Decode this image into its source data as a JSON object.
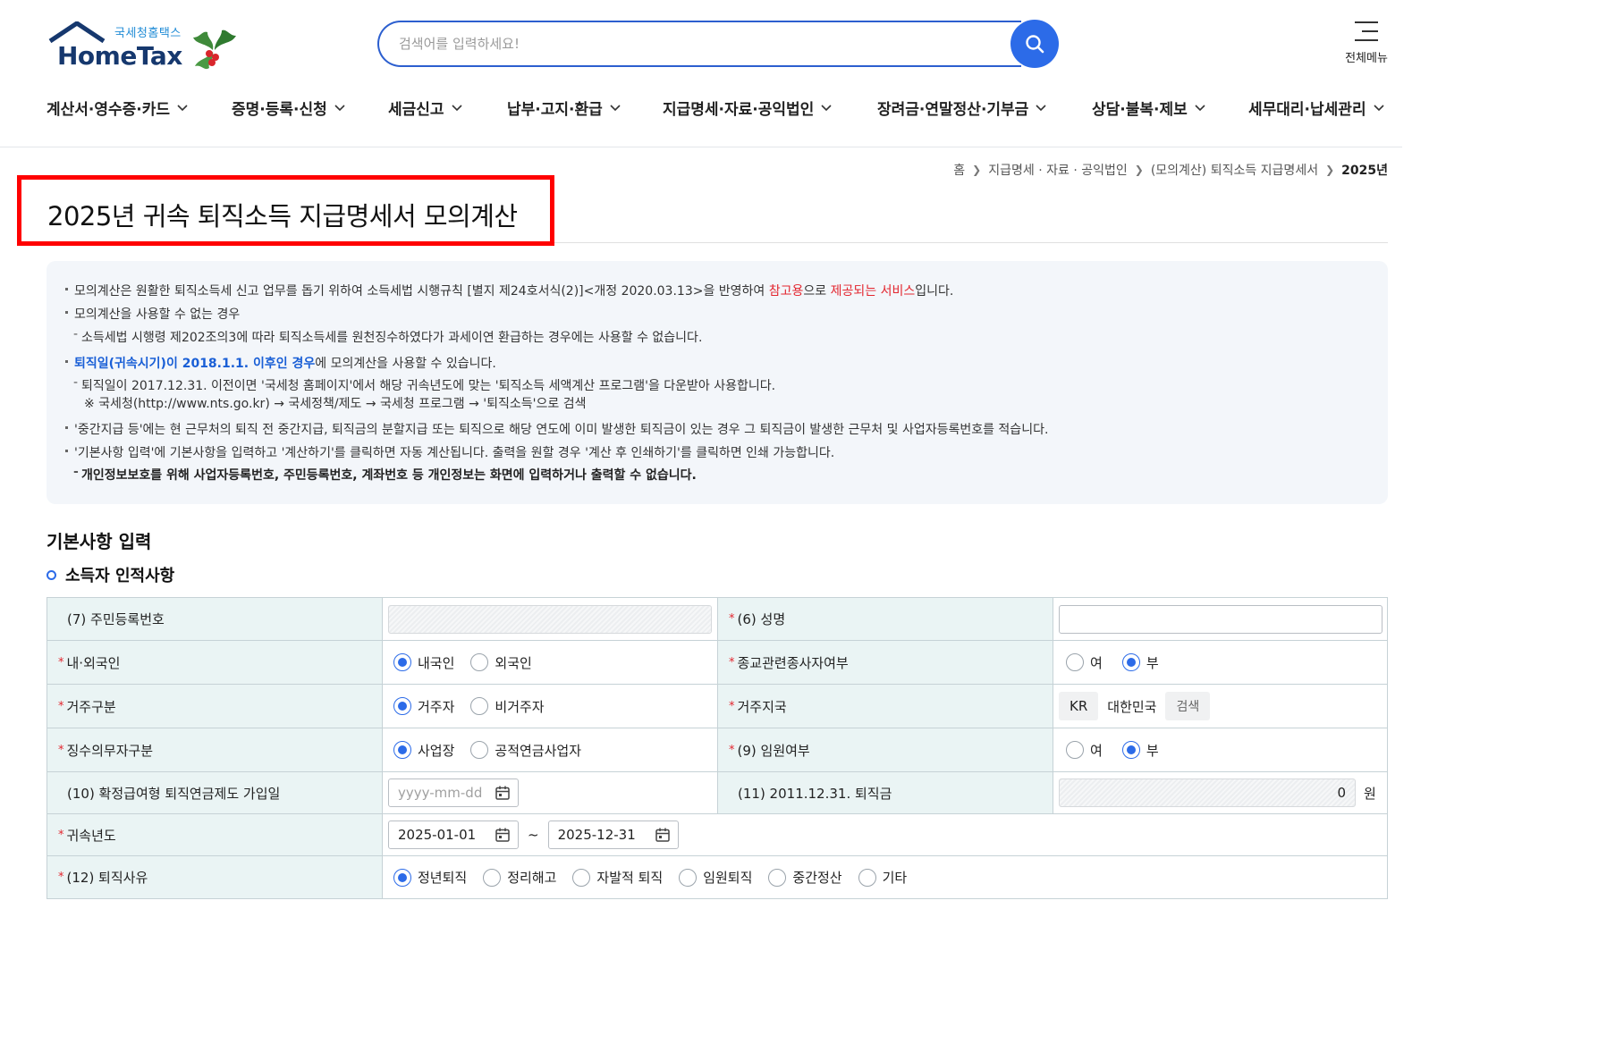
{
  "brand": {
    "sub": "국세청홈택스",
    "main": "HomeTax",
    "logo_icon": "house-roof-icon",
    "holly_icon": "holly-icon"
  },
  "search": {
    "placeholder": "검색어를 입력하세요!",
    "icon": "search-icon",
    "accent": "#2c6be8"
  },
  "all_menu": {
    "label": "전체메뉴",
    "icon": "hamburger-icon"
  },
  "gnb": [
    "계산서·영수증·카드",
    "증명·등록·신청",
    "세금신고",
    "납부·고지·환급",
    "지급명세·자료·공익법인",
    "장려금·연말정산·기부금",
    "상담·불복·제보",
    "세무대리·납세관리"
  ],
  "breadcrumb": [
    "홈",
    "지급명세 · 자료 · 공익법인",
    "(모의계산) 퇴직소득 지급명세서",
    "2025년"
  ],
  "page_title": "2025년 귀속 퇴직소득 지급명세서 모의계산",
  "notice": {
    "l1_a": "모의계산은 원활한 퇴직소득세 신고 업무를 돕기 위하여 소득세법 시행규칙 [별지 제24호서식(2)]<개정 2020.03.13>을 반영하여 ",
    "l1_red1": "참고용",
    "l1_b": "으로 ",
    "l1_red2": "제공되는 서비스",
    "l1_c": "입니다.",
    "l2": "모의계산을 사용할 수 없는 경우",
    "l3": "소득세법 시행령 제202조의3에 따라 퇴직소득세를 원천징수하였다가 과세이연 환급하는 경우에는 사용할 수 없습니다.",
    "l4_blue": "퇴직일(귀속시기)이 2018.1.1. 이후인 경우",
    "l4_b": "에 모의계산을 사용할 수 있습니다.",
    "l5": "퇴직일이 2017.12.31. 이전이면 '국세청 홈페이지'에서 해당 귀속년도에 맞는 '퇴직소득 세액계산 프로그램'을 다운받아 사용합니다.",
    "l6": "※ 국세청(http://www.nts.go.kr) → 국세정책/제도 → 국세청 프로그램 → '퇴직소득'으로 검색",
    "l7": "'중간지급 등'에는 현 근무처의 퇴직 전 중간지급, 퇴직금의 분할지급 또는 퇴직으로 해당 연도에 이미 발생한 퇴직금이 있는 경우 그 퇴직금이 발생한 근무처 및 사업자등록번호를 적습니다.",
    "l8": "'기본사항 입력'에 기본사항을 입력하고 '계산하기'를 클릭하면 자동 계산됩니다. 출력을 원할 경우 '계산 후 인쇄하기'를 클릭하면 인쇄 가능합니다.",
    "l9": "개인정보보호를 위해 사업자등록번호, 주민등록번호, 계좌번호 등 개인정보는 화면에 입력하거나 출력할 수 없습니다."
  },
  "form": {
    "section_title": "기본사항 입력",
    "sub_title": "소득자 인적사항",
    "required_mark": "*",
    "rrn_label": "(7) 주민등록번호",
    "name_label": "(6) 성명",
    "name_value": "",
    "nationality_label": "내·외국인",
    "nationality_options": [
      "내국인",
      "외국인"
    ],
    "nationality_selected": "내국인",
    "religious_label": "종교관련종사자여부",
    "yes_no_options": [
      "여",
      "부"
    ],
    "religious_selected": "부",
    "residence_label": "거주구분",
    "residence_options": [
      "거주자",
      "비거주자"
    ],
    "residence_selected": "거주자",
    "residence_country_label": "거주지국",
    "country_code": "KR",
    "country_name": "대한민국",
    "country_search": "검색",
    "withholder_label": "징수의무자구분",
    "withholder_options": [
      "사업장",
      "공적연금사업자"
    ],
    "withholder_selected": "사업장",
    "executive_label": "(9) 임원여부",
    "executive_selected": "부",
    "dc_join_label": "(10) 확정급여형 퇴직연금제도 가입일",
    "dc_join_placeholder": "yyyy-mm-dd",
    "severance_2011_label": "(11) 2011.12.31. 퇴직금",
    "severance_2011_value": "0",
    "won": "원",
    "year_label": "귀속년도",
    "year_from": "2025-01-01",
    "year_to": "2025-12-31",
    "tilde": "~",
    "reason_label": "(12) 퇴직사유",
    "reason_options": [
      "정년퇴직",
      "정리해고",
      "자발적 퇴직",
      "임원퇴직",
      "중간정산",
      "기타"
    ],
    "reason_selected": "정년퇴직"
  },
  "colors": {
    "highlight_border": "#ff0000",
    "required": "#e3262f",
    "accent_blue": "#2c6be8",
    "table_header_bg": "#eaf4f4",
    "notice_bg": "#f3f6fa"
  }
}
